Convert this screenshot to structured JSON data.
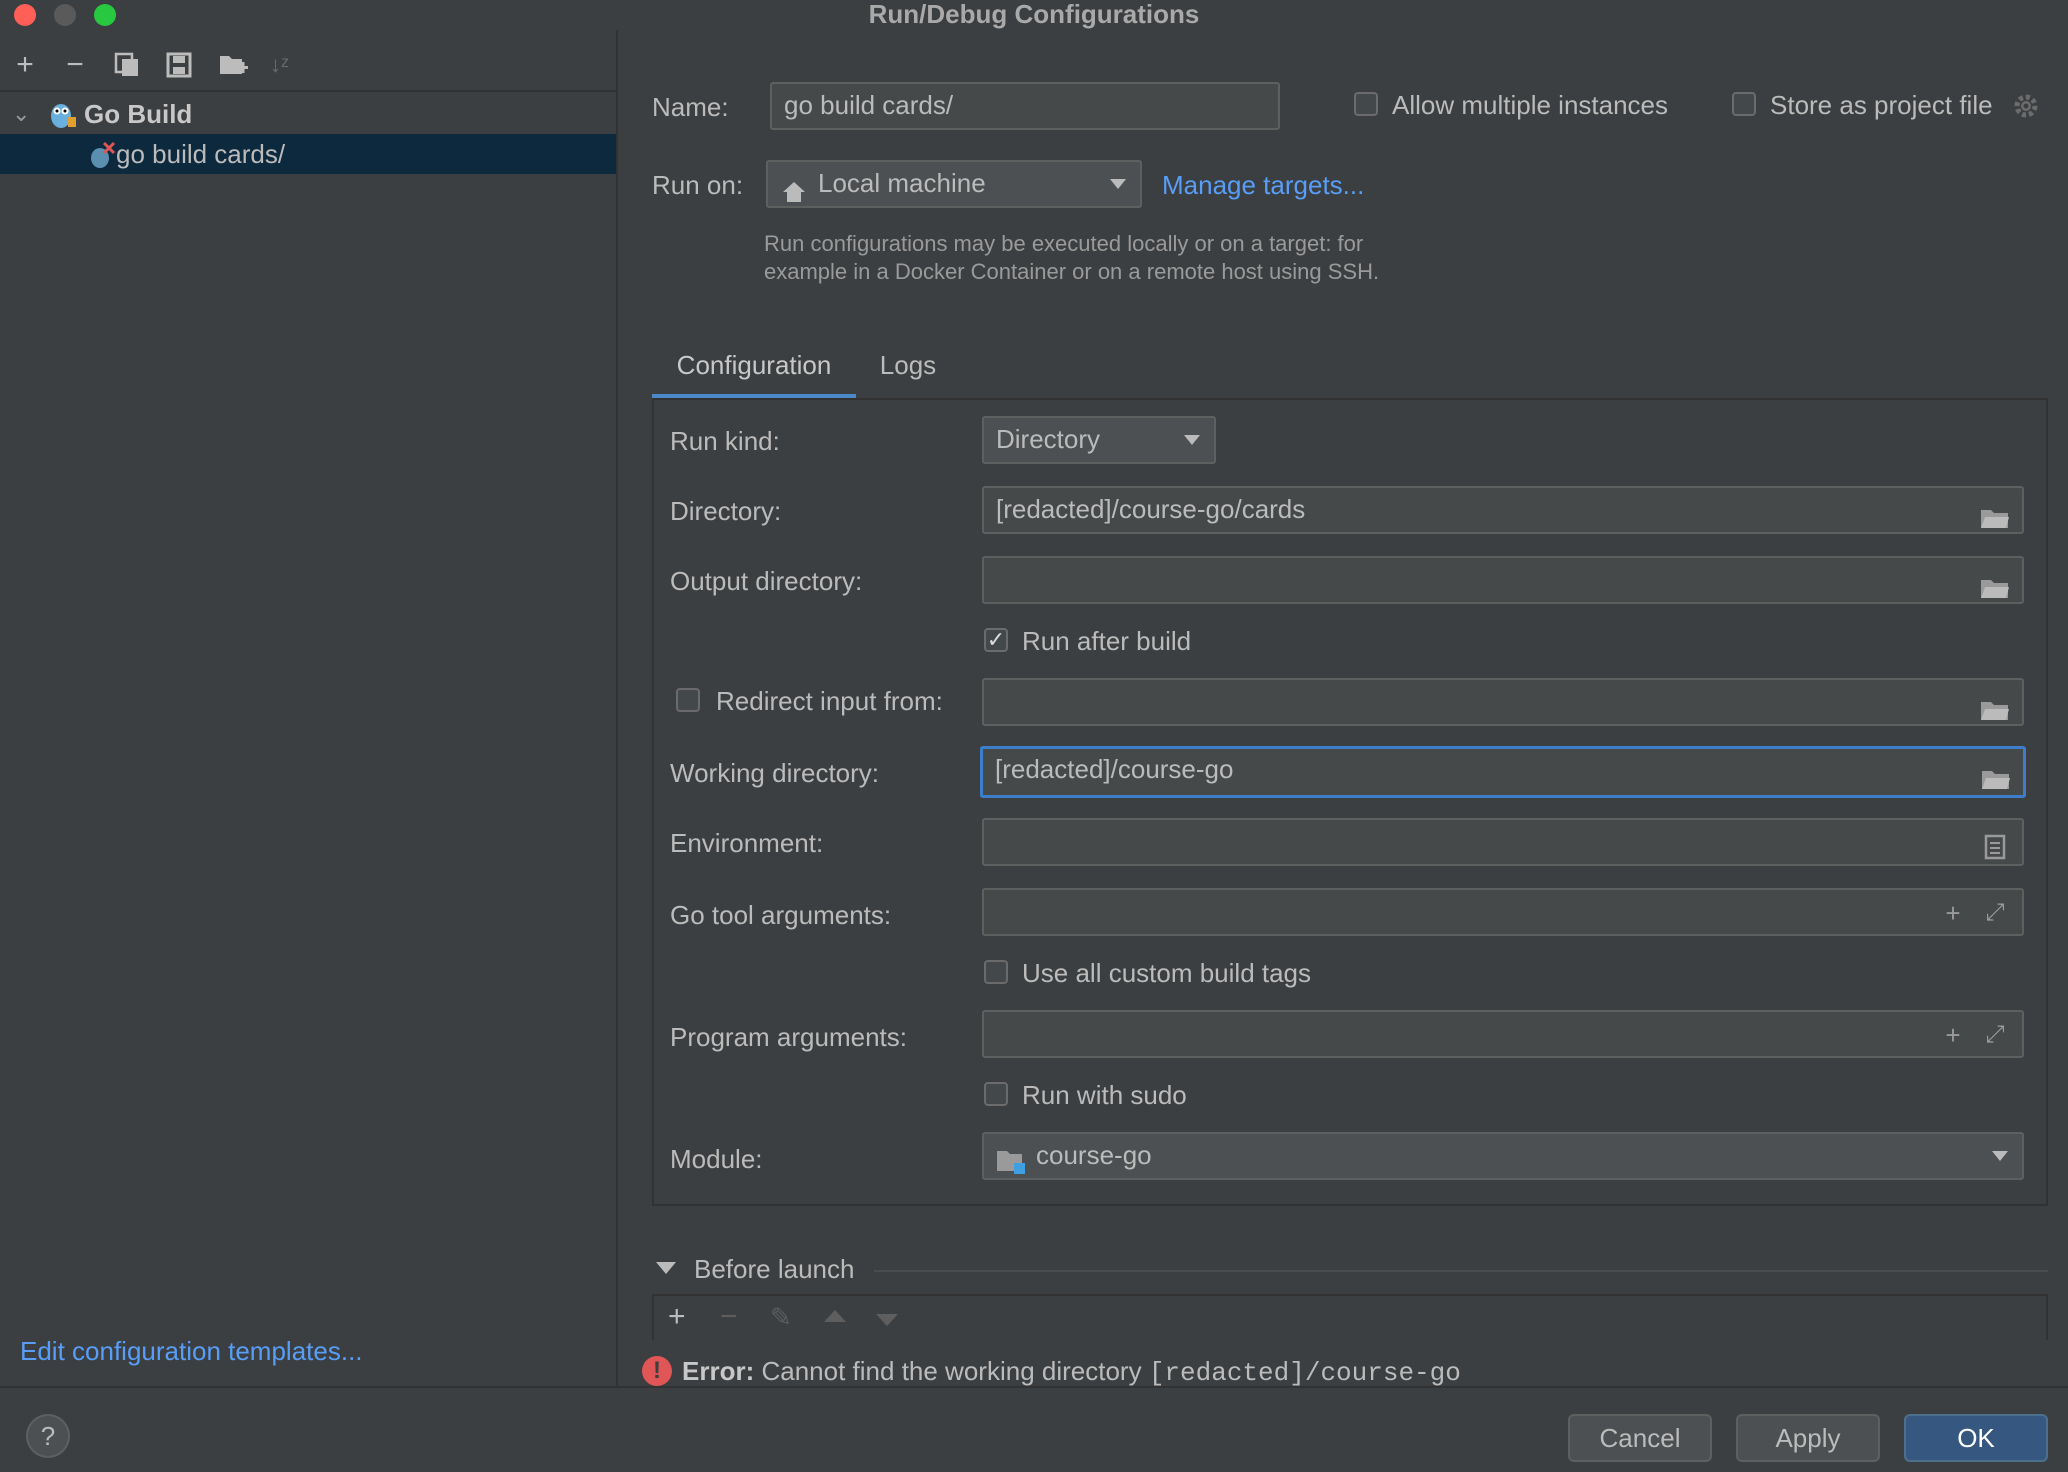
{
  "window": {
    "title": "Run/Debug Configurations"
  },
  "colors": {
    "accent": "#589df6",
    "selection": "#0d293e",
    "error": "#e05555",
    "default_button": "#365880",
    "focus": "#3d7dcc"
  },
  "left": {
    "toolbar": [
      "add-icon",
      "remove-icon",
      "copy-icon",
      "save-icon",
      "new-folder-icon",
      "sort-icon"
    ],
    "tree": {
      "group": "Go Build",
      "item": "go build cards/"
    },
    "edit_templates": "Edit configuration templates..."
  },
  "top": {
    "name_label": "Name:",
    "name_value": "go build cards/",
    "allow_multiple": "Allow multiple instances",
    "store_project": "Store as project file",
    "run_on_label": "Run on:",
    "run_on_value": "Local machine",
    "manage_targets": "Manage targets...",
    "hint_line1": "Run configurations may be executed locally or on a target: for",
    "hint_line2": "example in a Docker Container or on a remote host using SSH."
  },
  "tabs": {
    "configuration": "Configuration",
    "logs": "Logs"
  },
  "config": {
    "run_kind_label": "Run kind:",
    "run_kind_value": "Directory",
    "directory_label": "Directory:",
    "directory_value": "[redacted]/course-go/cards",
    "output_dir_label": "Output directory:",
    "output_dir_value": "",
    "run_after_build": "Run after build",
    "run_after_build_checked": true,
    "redirect_input": "Redirect input from:",
    "redirect_value": "",
    "working_dir_label": "Working directory:",
    "working_dir_value": "[redacted]/course-go",
    "environment_label": "Environment:",
    "environment_value": "",
    "go_tool_args_label": "Go tool arguments:",
    "go_tool_args_value": "",
    "custom_build_tags": "Use all custom build tags",
    "program_args_label": "Program arguments:",
    "program_args_value": "",
    "run_with_sudo": "Run with sudo",
    "module_label": "Module:",
    "module_value": "course-go"
  },
  "before_launch": {
    "title": "Before launch"
  },
  "error": {
    "prefix": "Error:",
    "message": "Cannot find the working directory",
    "path": "[redacted]/course-go"
  },
  "buttons": {
    "help": "?",
    "cancel": "Cancel",
    "apply": "Apply",
    "ok": "OK"
  }
}
